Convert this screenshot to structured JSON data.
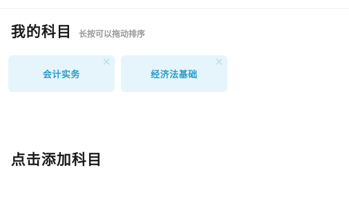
{
  "my_subjects": {
    "title": "我的科目",
    "hint": "长按可以拖动排序",
    "items": [
      {
        "label": "会计实务",
        "remove_glyph": "×"
      },
      {
        "label": "经济法基础",
        "remove_glyph": "×"
      }
    ]
  },
  "add_section": {
    "title": "点击添加科目"
  },
  "colors": {
    "card_background": "#e6f5fb",
    "card_text": "#2a9bc9",
    "remove_icon": "#b9e2f2",
    "title_text": "#1a1a1a",
    "hint_text": "#9a9a9a"
  }
}
